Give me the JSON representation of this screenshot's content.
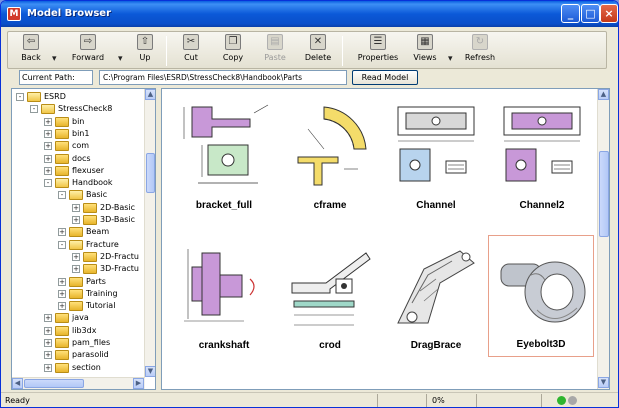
{
  "window": {
    "title": "Model Browser",
    "app_icon": "M"
  },
  "caption_buttons": {
    "minimize": "_",
    "maximize": "□",
    "close": "×"
  },
  "toolbar": {
    "back": "Back",
    "forward": "Forward",
    "up": "Up",
    "cut": "Cut",
    "copy": "Copy",
    "paste": "Paste",
    "delete": "Delete",
    "properties": "Properties",
    "views": "Views",
    "refresh": "Refresh"
  },
  "path": {
    "label": "Current Path:",
    "value": "C:\\Program Files\\ESRD\\StressCheck8\\Handbook\\Parts",
    "read_button": "Read Model"
  },
  "tree": {
    "items": [
      {
        "label": "ESRD",
        "depth": 0,
        "expander": "-",
        "open": true
      },
      {
        "label": "StressCheck8",
        "depth": 1,
        "expander": "-",
        "open": true
      },
      {
        "label": "bin",
        "depth": 2,
        "expander": "+",
        "open": false
      },
      {
        "label": "bin1",
        "depth": 2,
        "expander": "+",
        "open": false
      },
      {
        "label": "com",
        "depth": 2,
        "expander": "+",
        "open": false
      },
      {
        "label": "docs",
        "depth": 2,
        "expander": "+",
        "open": false
      },
      {
        "label": "flexuser",
        "depth": 2,
        "expander": "+",
        "open": false
      },
      {
        "label": "Handbook",
        "depth": 2,
        "expander": "-",
        "open": true
      },
      {
        "label": "Basic",
        "depth": 3,
        "expander": "-",
        "open": true
      },
      {
        "label": "2D-Basic",
        "depth": 4,
        "expander": "+",
        "open": false
      },
      {
        "label": "3D-Basic",
        "depth": 4,
        "expander": "+",
        "open": false
      },
      {
        "label": "Beam",
        "depth": 3,
        "expander": "+",
        "open": false
      },
      {
        "label": "Fracture",
        "depth": 3,
        "expander": "-",
        "open": true
      },
      {
        "label": "2D-Fractu",
        "depth": 4,
        "expander": "+",
        "open": false
      },
      {
        "label": "3D-Fractu",
        "depth": 4,
        "expander": "+",
        "open": false
      },
      {
        "label": "Parts",
        "depth": 3,
        "expander": "+",
        "open": false
      },
      {
        "label": "Training",
        "depth": 3,
        "expander": "+",
        "open": false
      },
      {
        "label": "Tutorial",
        "depth": 3,
        "expander": "+",
        "open": false
      },
      {
        "label": "java",
        "depth": 2,
        "expander": "+",
        "open": false
      },
      {
        "label": "lib3dx",
        "depth": 2,
        "expander": "+",
        "open": false
      },
      {
        "label": "pam_files",
        "depth": 2,
        "expander": "+",
        "open": false
      },
      {
        "label": "parasolid",
        "depth": 2,
        "expander": "+",
        "open": false
      },
      {
        "label": "section",
        "depth": 2,
        "expander": "+",
        "open": false
      }
    ]
  },
  "models": [
    {
      "name": "bracket_full",
      "icon": "bracket-drawing-icon",
      "selected": false
    },
    {
      "name": "cframe",
      "icon": "curved-frame-drawing-icon",
      "selected": false
    },
    {
      "name": "Channel",
      "icon": "channel-drawing-icon",
      "selected": false
    },
    {
      "name": "Channel2",
      "icon": "channel2-drawing-icon",
      "selected": false
    },
    {
      "name": "crankshaft",
      "icon": "crankshaft-drawing-icon",
      "selected": false
    },
    {
      "name": "crod",
      "icon": "crod-drawing-icon",
      "selected": false
    },
    {
      "name": "DragBrace",
      "icon": "drag-brace-render-icon",
      "selected": false
    },
    {
      "name": "Eyebolt3D",
      "icon": "eyebolt-render-icon",
      "selected": true
    }
  ],
  "status": {
    "text": "Ready",
    "progress": "0%"
  },
  "colors": {
    "title_blue": "#0a5fe0",
    "selection": "#e8a08a",
    "led_green": "#2fb52f",
    "led_gray": "#a8a8a8"
  }
}
